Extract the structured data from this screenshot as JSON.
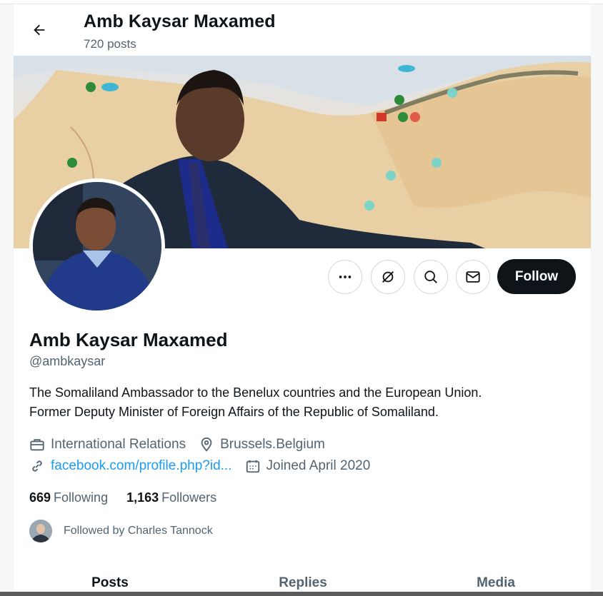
{
  "header": {
    "name": "Amb Kaysar Maxamed",
    "posts": "720 posts"
  },
  "profile": {
    "name": "Amb Kaysar Maxamed",
    "handle": "@ambkaysar",
    "bio_line1": "The Somaliland Ambassador to the Benelux countries and the European Union.",
    "bio_line2": "Former Deputy Minister of Foreign Affairs of the Republic of Somaliland.",
    "category": "International Relations",
    "location": "Brussels.Belgium",
    "website": "facebook.com/profile.php?id...",
    "joined": "Joined April 2020"
  },
  "actions": {
    "follow_label": "Follow",
    "icons": [
      "more-icon",
      "grok-icon",
      "search-icon",
      "message-icon"
    ]
  },
  "stats": {
    "following_count": "669",
    "following_label": "Following",
    "followers_count": "1,163",
    "followers_label": "Followers"
  },
  "followed_by": "Followed by Charles Tannock",
  "tabs": [
    "Posts",
    "Replies",
    "Media"
  ],
  "colors": {
    "accent": "#1d9bf0",
    "text": "#0f1419",
    "secondary": "#536471",
    "follow_bg": "#0f1419"
  }
}
